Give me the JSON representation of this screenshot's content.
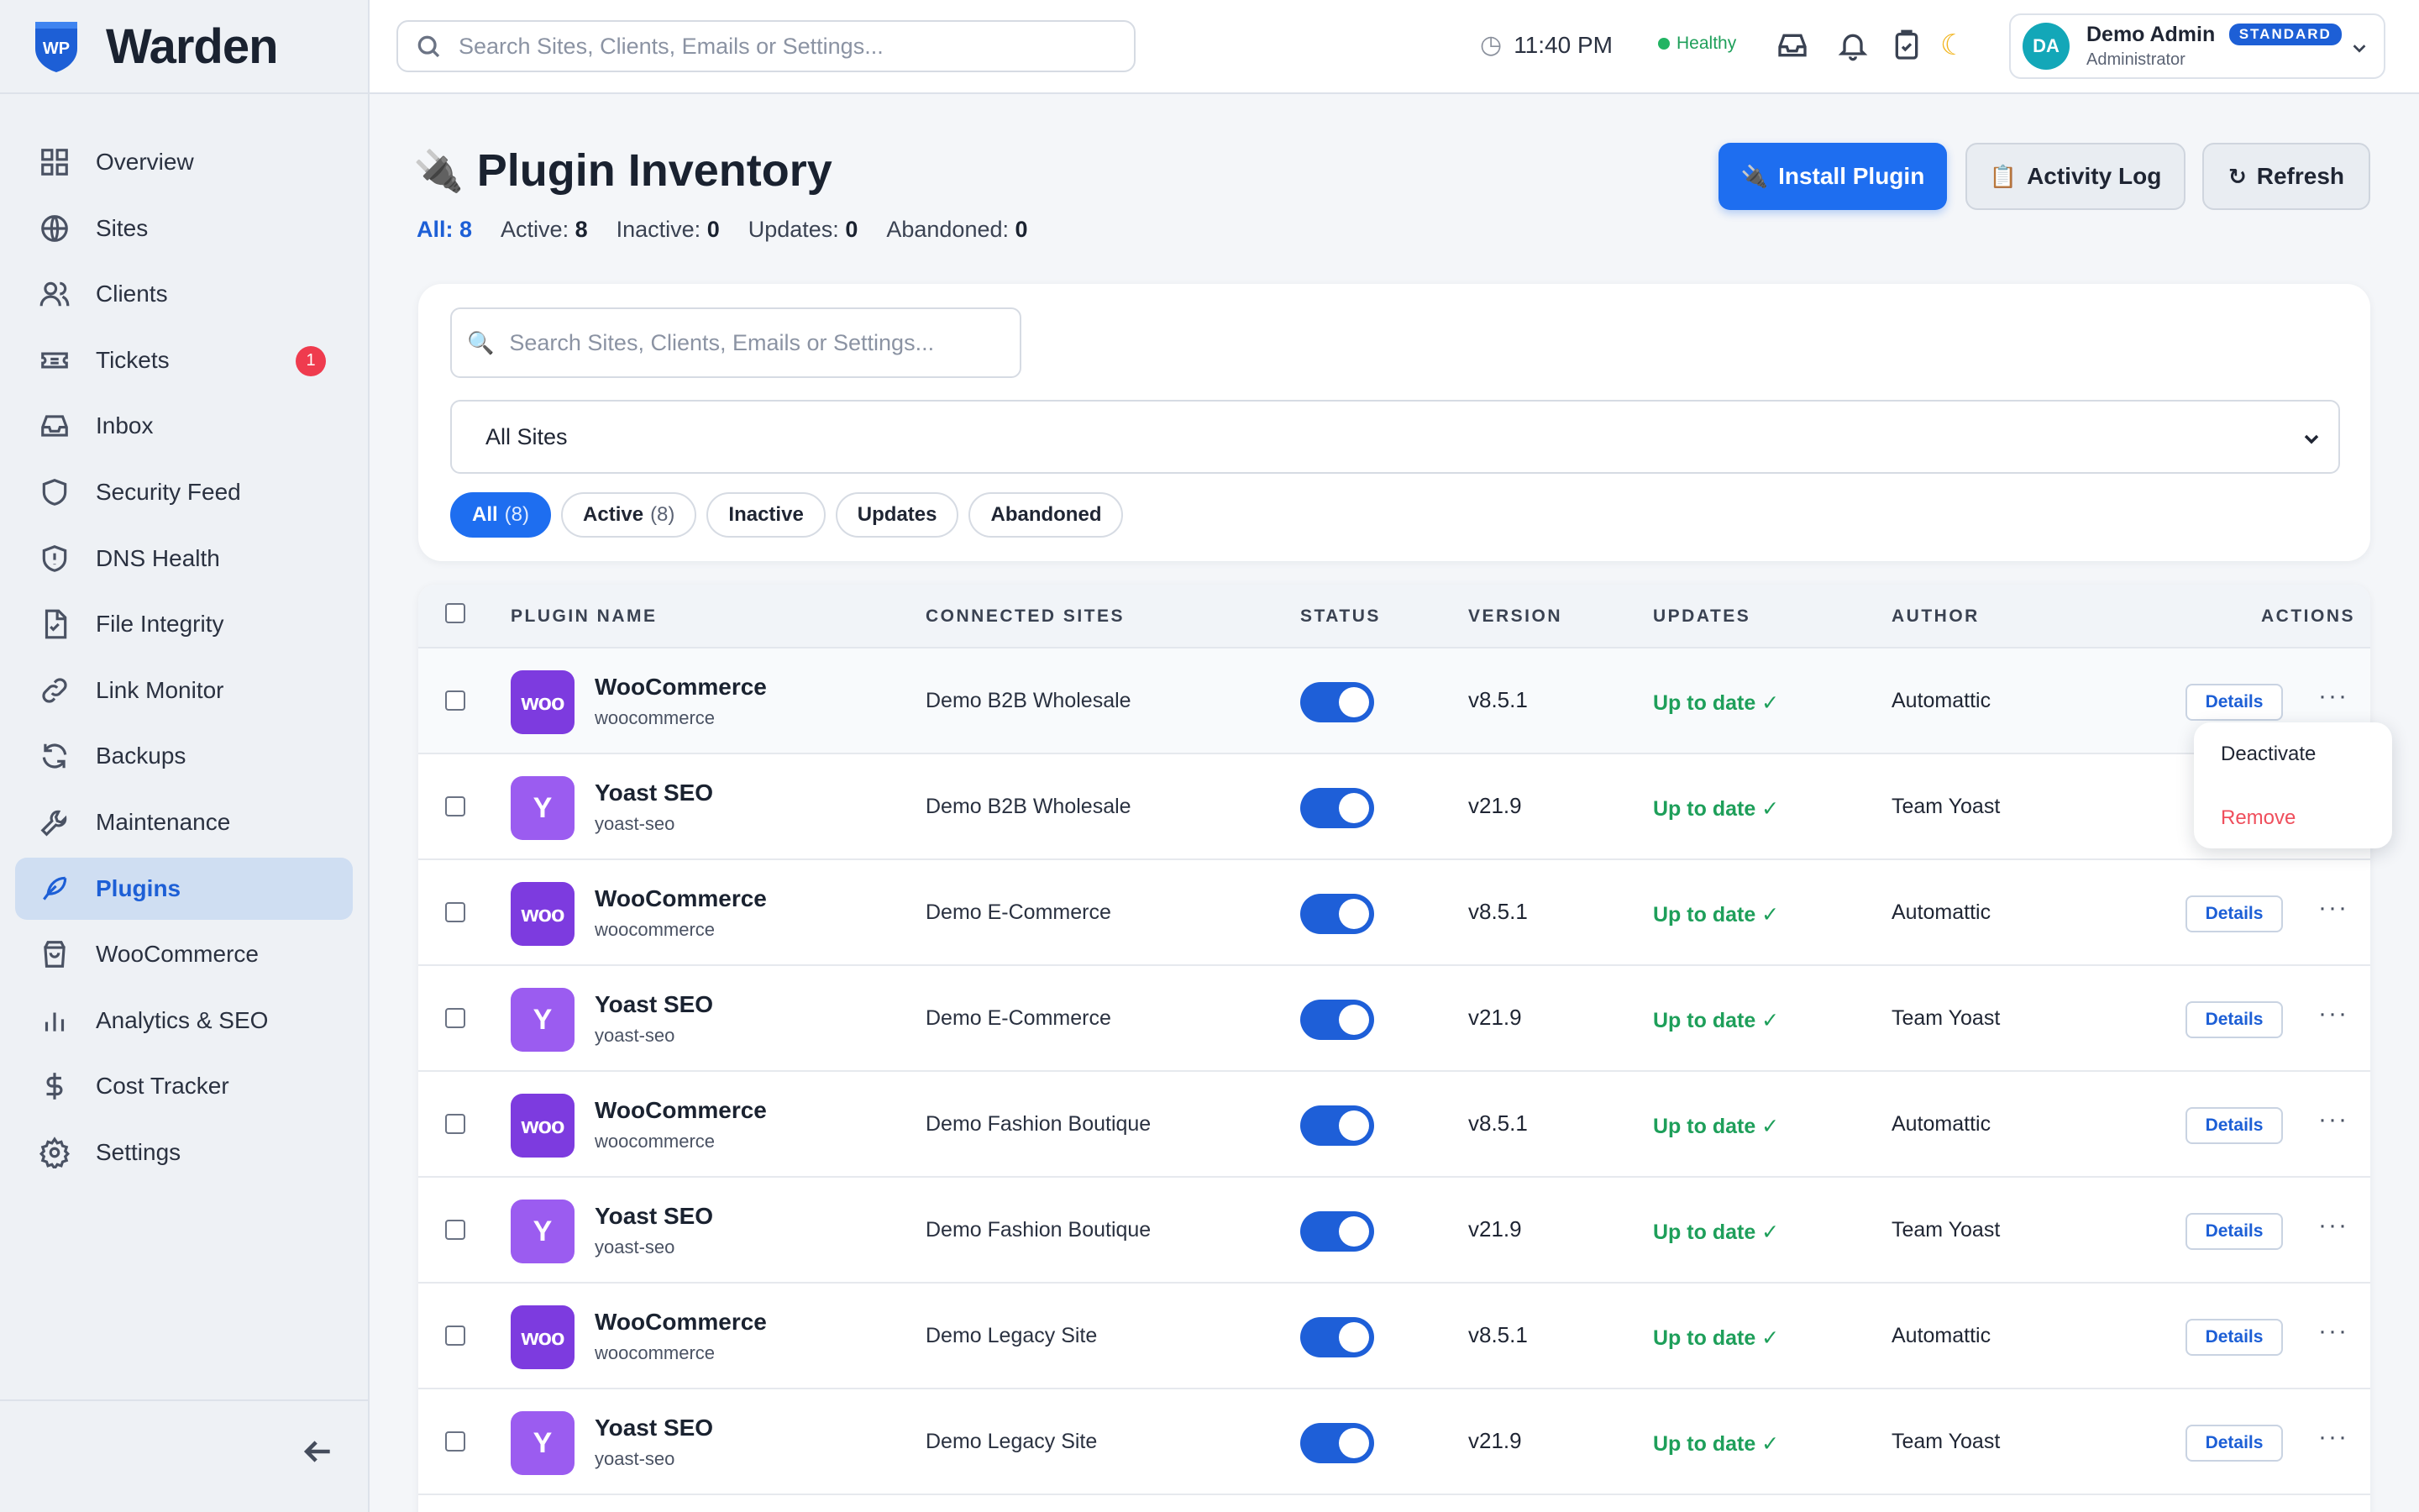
{
  "brand": {
    "name": "Warden",
    "logo_text": "WP"
  },
  "sidebar": {
    "items": [
      {
        "label": "Overview",
        "icon": "grid-icon"
      },
      {
        "label": "Sites",
        "icon": "globe-icon"
      },
      {
        "label": "Clients",
        "icon": "users-icon"
      },
      {
        "label": "Tickets",
        "icon": "ticket-icon",
        "badge": "1"
      },
      {
        "label": "Inbox",
        "icon": "inbox-icon"
      },
      {
        "label": "Security Feed",
        "icon": "shield-icon"
      },
      {
        "label": "DNS Health",
        "icon": "shield-alert-icon"
      },
      {
        "label": "File Integrity",
        "icon": "file-check-icon"
      },
      {
        "label": "Link Monitor",
        "icon": "link-icon"
      },
      {
        "label": "Backups",
        "icon": "refresh-icon"
      },
      {
        "label": "Maintenance",
        "icon": "wrench-icon"
      },
      {
        "label": "Plugins",
        "icon": "feather-icon",
        "active": true
      },
      {
        "label": "WooCommerce",
        "icon": "shopping-bag-icon"
      },
      {
        "label": "Analytics & SEO",
        "icon": "bar-chart-icon"
      },
      {
        "label": "Cost Tracker",
        "icon": "dollar-icon"
      },
      {
        "label": "Settings",
        "icon": "gear-icon"
      }
    ]
  },
  "topbar": {
    "search_placeholder": "Search Sites, Clients, Emails or Settings...",
    "time": "11:40 PM",
    "health": "Healthy",
    "user": {
      "initials": "DA",
      "name": "Demo Admin",
      "plan": "STANDARD",
      "role": "Administrator"
    }
  },
  "page": {
    "title": "Plugin Inventory",
    "counts": [
      {
        "label": "All:",
        "value": "8"
      },
      {
        "label": "Active:",
        "value": "8"
      },
      {
        "label": "Inactive:",
        "value": "0"
      },
      {
        "label": "Updates:",
        "value": "0"
      },
      {
        "label": "Abandoned:",
        "value": "0"
      }
    ],
    "buttons": {
      "install": "Install Plugin",
      "activity": "Activity Log",
      "refresh": "Refresh"
    }
  },
  "filters": {
    "search_placeholder": "Search Sites, Clients, Emails or Settings...",
    "site_select": "All Sites",
    "pills": [
      {
        "label": "All",
        "count": "(8)",
        "active": true
      },
      {
        "label": "Active",
        "count": "(8)"
      },
      {
        "label": "Inactive",
        "count": ""
      },
      {
        "label": "Updates",
        "count": ""
      },
      {
        "label": "Abandoned",
        "count": ""
      }
    ]
  },
  "table": {
    "headers": {
      "name": "PLUGIN NAME",
      "sites": "CONNECTED SITES",
      "status": "STATUS",
      "version": "VERSION",
      "updates": "UPDATES",
      "author": "AUTHOR",
      "actions": "ACTIONS"
    },
    "details_label": "Details",
    "more_label": "···",
    "rows": [
      {
        "icon": "woo",
        "icon_text": "woo",
        "name": "WooCommerce",
        "slug": "woocommerce",
        "site": "Demo B2B Wholesale",
        "active": true,
        "version": "v8.5.1",
        "updates": "Up to date ✓",
        "author": "Automattic"
      },
      {
        "icon": "yoast",
        "icon_text": "Y",
        "name": "Yoast SEO",
        "slug": "yoast-seo",
        "site": "Demo B2B Wholesale",
        "active": true,
        "version": "v21.9",
        "updates": "Up to date ✓",
        "author": "Team Yoast"
      },
      {
        "icon": "woo",
        "icon_text": "woo",
        "name": "WooCommerce",
        "slug": "woocommerce",
        "site": "Demo E-Commerce",
        "active": true,
        "version": "v8.5.1",
        "updates": "Up to date ✓",
        "author": "Automattic"
      },
      {
        "icon": "yoast",
        "icon_text": "Y",
        "name": "Yoast SEO",
        "slug": "yoast-seo",
        "site": "Demo E-Commerce",
        "active": true,
        "version": "v21.9",
        "updates": "Up to date ✓",
        "author": "Team Yoast"
      },
      {
        "icon": "woo",
        "icon_text": "woo",
        "name": "WooCommerce",
        "slug": "woocommerce",
        "site": "Demo Fashion Boutique",
        "active": true,
        "version": "v8.5.1",
        "updates": "Up to date ✓",
        "author": "Automattic"
      },
      {
        "icon": "yoast",
        "icon_text": "Y",
        "name": "Yoast SEO",
        "slug": "yoast-seo",
        "site": "Demo Fashion Boutique",
        "active": true,
        "version": "v21.9",
        "updates": "Up to date ✓",
        "author": "Team Yoast"
      },
      {
        "icon": "woo",
        "icon_text": "woo",
        "name": "WooCommerce",
        "slug": "woocommerce",
        "site": "Demo Legacy Site",
        "active": true,
        "version": "v8.5.1",
        "updates": "Up to date ✓",
        "author": "Automattic"
      },
      {
        "icon": "yoast",
        "icon_text": "Y",
        "name": "Yoast SEO",
        "slug": "yoast-seo",
        "site": "Demo Legacy Site",
        "active": true,
        "version": "v21.9",
        "updates": "Up to date ✓",
        "author": "Team Yoast"
      }
    ],
    "row_menu": {
      "deactivate": "Deactivate",
      "remove": "Remove"
    }
  }
}
